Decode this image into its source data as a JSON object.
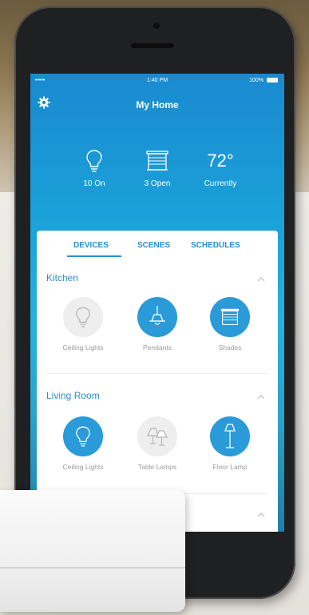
{
  "status_bar": {
    "signal": "•••••",
    "time": "1:40 PM",
    "battery": "100%"
  },
  "header": {
    "title": "My Home",
    "settings_icon": "gear-icon"
  },
  "summary": [
    {
      "icon": "lightbulb-icon",
      "label": "10 On"
    },
    {
      "icon": "window-shade-icon",
      "label": "3 Open"
    },
    {
      "value": "72°",
      "label": "Currently"
    }
  ],
  "tabs": [
    {
      "label": "DEVICES",
      "active": true
    },
    {
      "label": "SCENES",
      "active": false
    },
    {
      "label": "SCHEDULES",
      "active": false
    }
  ],
  "rooms": [
    {
      "name": "Kitchen",
      "devices": [
        {
          "label": "Ceiling Lights",
          "icon": "lightbulb-icon",
          "state": "off"
        },
        {
          "label": "Pendants",
          "icon": "pendant-lamp-icon",
          "state": "on"
        },
        {
          "label": "Shades",
          "icon": "window-shade-icon",
          "state": "on"
        }
      ]
    },
    {
      "name": "Living Room",
      "devices": [
        {
          "label": "Ceiling Lights",
          "icon": "lightbulb-icon",
          "state": "on"
        },
        {
          "label": "Table Lamps",
          "icon": "table-lamps-icon",
          "state": "off"
        },
        {
          "label": "Floor Lamp",
          "icon": "floor-lamp-icon",
          "state": "on"
        }
      ]
    }
  ],
  "colors": {
    "accent": "#2a9ad8",
    "off_circle": "#eeeeee",
    "label_gray": "#9a9a9a"
  }
}
